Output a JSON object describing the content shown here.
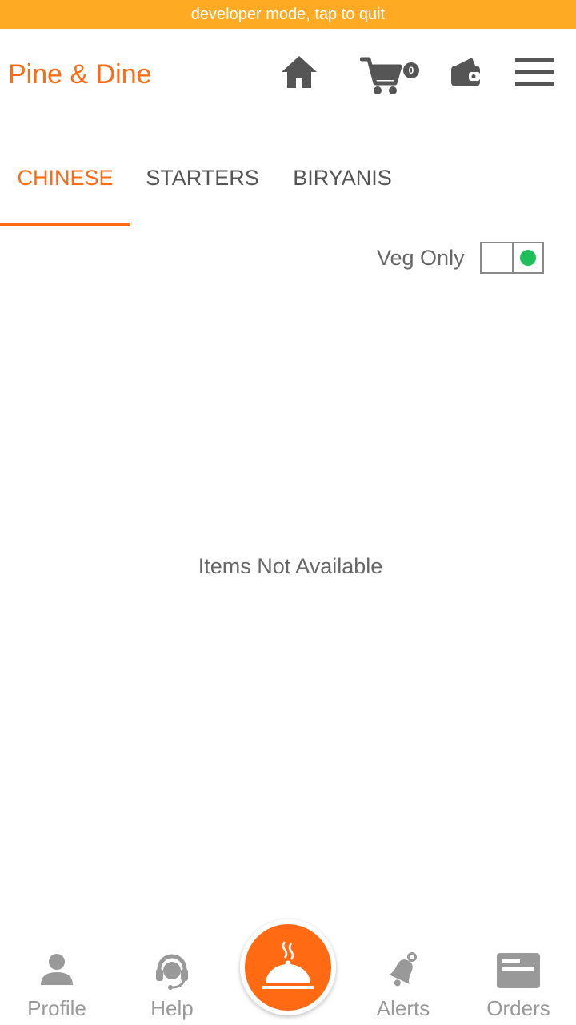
{
  "dev_banner": "developer mode, tap to quit",
  "header": {
    "title": "Pine & Dine",
    "cart_count": "0",
    "icons": [
      "home-icon",
      "cart-icon",
      "wallet-icon",
      "menu-icon"
    ]
  },
  "tabs": [
    {
      "label": "CHINESE",
      "active": true
    },
    {
      "label": "STARTERS",
      "active": false
    },
    {
      "label": "BIRYANIS",
      "active": false
    }
  ],
  "veg_filter": {
    "label": "Veg Only",
    "on": true,
    "indicator_color": "#1EBE5A"
  },
  "empty_message": "Items Not Available",
  "bottom_nav": {
    "profile": "Profile",
    "help": "Help",
    "alerts": "Alerts",
    "orders": "Orders",
    "center_icon": "cloche-icon"
  },
  "colors": {
    "accent": "#FF6A13",
    "banner": "#FFAA22",
    "icon_dark": "#555555",
    "icon_light": "#999999"
  }
}
